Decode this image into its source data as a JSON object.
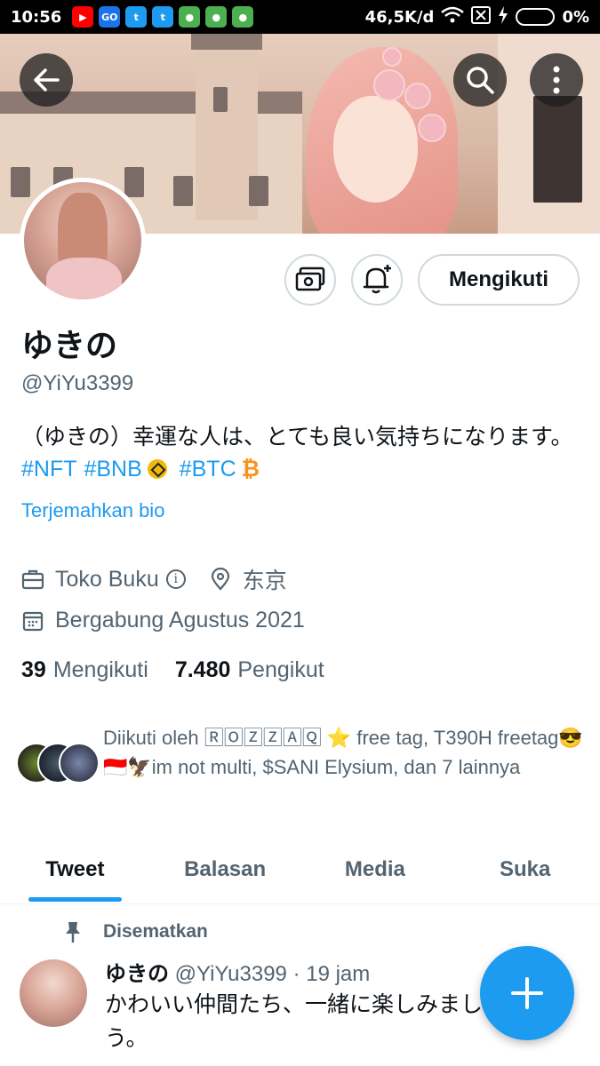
{
  "status_bar": {
    "time": "10:56",
    "speed": "46,5K/d",
    "battery": "0%",
    "app_icons": [
      "youtube-icon",
      "go-icon",
      "twitter-icon",
      "twitter-icon",
      "chrome-icon",
      "chrome-icon",
      "chrome-icon"
    ]
  },
  "profile": {
    "display_name": "ゆきの",
    "handle": "@YiYu3399",
    "bio_text": "（ゆきの）幸運な人は、とても良い気持ちになります。",
    "bio_tags": [
      "#NFT",
      "#BNB",
      "#BTC"
    ],
    "translate_label": "Terjemahkan bio",
    "category": "Toko Buku",
    "location": "东京",
    "joined": "Bergabung Agustus 2021",
    "following_count": "39",
    "following_label": "Mengikuti",
    "followers_count": "7.480",
    "followers_label": "Pengikut",
    "followed_by": "Diikuti oleh 🅁🄾🅉🅉🄰🅀 ⭐ free tag, T390H freetag😎🇮🇩🦅im not multi, $SANI Elysium, dan 7 lainnya"
  },
  "actions": {
    "follow_label": "Mengikuti"
  },
  "tabs": [
    {
      "label": "Tweet",
      "active": true
    },
    {
      "label": "Balasan",
      "active": false
    },
    {
      "label": "Media",
      "active": false
    },
    {
      "label": "Suka",
      "active": false
    }
  ],
  "pinned_tweet": {
    "pinned_label": "Disematkan",
    "author_name": "ゆきの",
    "author_handle": "@YiYu3399",
    "time": "· 19 jam",
    "text": "かわいい仲間たち、一緒に楽しみましょう。"
  },
  "colors": {
    "accent": "#1d9bf0",
    "secondary_text": "#536471",
    "primary_text": "#0f1419",
    "border": "#cfd9de"
  }
}
